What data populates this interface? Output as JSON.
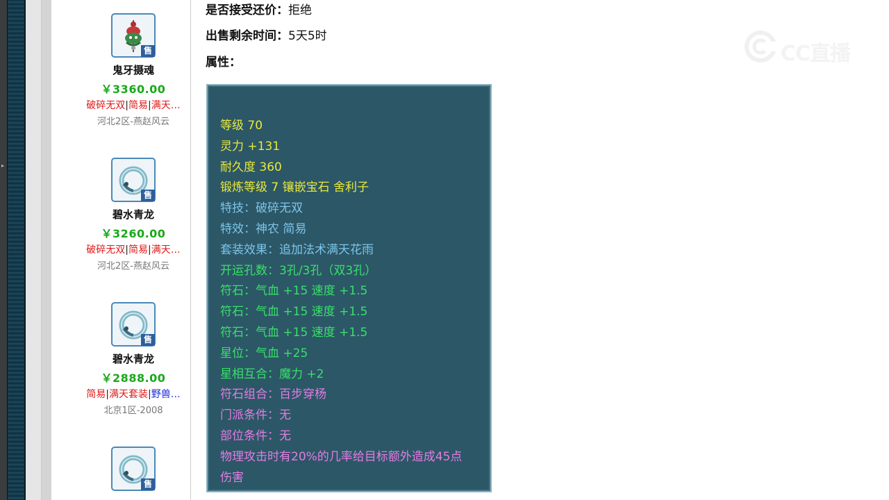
{
  "detail": {
    "counter_offer_label": "是否接受还价：",
    "counter_offer_value": "拒绝",
    "time_left_label": "出售剩余时间：",
    "time_left_value": "5天5时",
    "attributes_label": "属性："
  },
  "items": [
    {
      "name": "鬼牙摄魂",
      "price": "￥3360.00",
      "tags": [
        {
          "text": "破碎无双",
          "color": "red"
        },
        {
          "text": "简易",
          "color": "red"
        },
        {
          "text": "满天…",
          "color": "red"
        }
      ],
      "server": "河北2区-燕赵风云",
      "sell_badge": "售",
      "icon": "ghost-fang-icon"
    },
    {
      "name": "碧水青龙",
      "price": "￥3260.00",
      "tags": [
        {
          "text": "破碎无双",
          "color": "red"
        },
        {
          "text": "简易",
          "color": "red"
        },
        {
          "text": "满天…",
          "color": "red"
        }
      ],
      "server": "河北2区-燕赵风云",
      "sell_badge": "售",
      "icon": "jade-dragon-ring-icon"
    },
    {
      "name": "碧水青龙",
      "price": "￥2888.00",
      "tags": [
        {
          "text": "简易",
          "color": "red"
        },
        {
          "text": "满天套装",
          "color": "red"
        },
        {
          "text": "野兽…",
          "color": "blue"
        }
      ],
      "server": "北京1区-2008",
      "sell_badge": "售",
      "icon": "jade-dragon-ring-icon"
    },
    {
      "name": "",
      "price": "",
      "tags": [],
      "server": "",
      "sell_badge": "售",
      "icon": "jade-dragon-ring-icon"
    }
  ],
  "attributes": [
    {
      "text": "等级 70",
      "color": "yellow"
    },
    {
      "text": "灵力 +131",
      "color": "yellow"
    },
    {
      "text": "耐久度 360",
      "color": "yellow"
    },
    {
      "text": "锻炼等级 7 镶嵌宝石 舍利子",
      "color": "yellow"
    },
    {
      "text": "特技：破碎无双",
      "color": "lblue"
    },
    {
      "text": "特效：神农 简易",
      "color": "lblue"
    },
    {
      "text": "套装效果：追加法术满天花雨",
      "color": "lblue"
    },
    {
      "text": "开运孔数：3孔/3孔（双3孔）",
      "color": "green"
    },
    {
      "text": "符石：气血 +15 速度 +1.5",
      "color": "green"
    },
    {
      "text": "符石：气血 +15 速度 +1.5",
      "color": "green"
    },
    {
      "text": "符石：气血 +15 速度 +1.5",
      "color": "green"
    },
    {
      "text": "星位：气血 +25",
      "color": "green"
    },
    {
      "text": "星相互合：魔力 +2",
      "color": "green"
    },
    {
      "text": "符石组合：百步穿杨",
      "color": "pink"
    },
    {
      "text": "门派条件：无",
      "color": "pink"
    },
    {
      "text": "部位条件：无",
      "color": "pink"
    },
    {
      "text": "物理攻击时有20%的几率给目标额外造成45点",
      "color": "pink"
    },
    {
      "text": "伤害",
      "color": "pink"
    }
  ],
  "watermark": {
    "small": "CC直播",
    "big": "CC直播"
  }
}
